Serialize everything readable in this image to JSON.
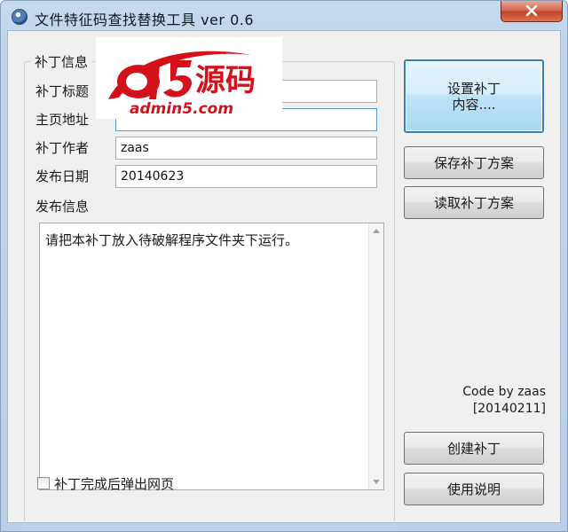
{
  "window": {
    "title": "文件特征码查找替换工具  ver 0.6",
    "icon": "app-logo-icon"
  },
  "group": {
    "legend": "补丁信息",
    "fields": {
      "title": {
        "label": "补丁标题",
        "value": ""
      },
      "homepage": {
        "label": "主页地址",
        "value": ""
      },
      "author": {
        "label": "补丁作者",
        "value": "zaas"
      },
      "date": {
        "label": "发布日期",
        "value": "20140623"
      }
    },
    "release_info": {
      "label": "发布信息",
      "value": "请把本补丁放入待破解程序文件夹下运行。"
    },
    "popup_checkbox": {
      "label": "补丁完成后弹出网页",
      "checked": false
    }
  },
  "buttons": {
    "set_content_line1": "设置补丁",
    "set_content_line2": "内容....",
    "save_scheme": "保存补丁方案",
    "load_scheme": "读取补丁方案",
    "create_patch": "创建补丁",
    "instructions": "使用说明"
  },
  "credit": {
    "line1": "Code by zaas",
    "line2": "[20140211]"
  },
  "watermark": {
    "logo_text": "a5源码",
    "url": "admin5.com"
  },
  "colors": {
    "watermark_red": "#d4101a",
    "primary_button_border": "#3c7fb1",
    "close_button": "#c0432a"
  }
}
